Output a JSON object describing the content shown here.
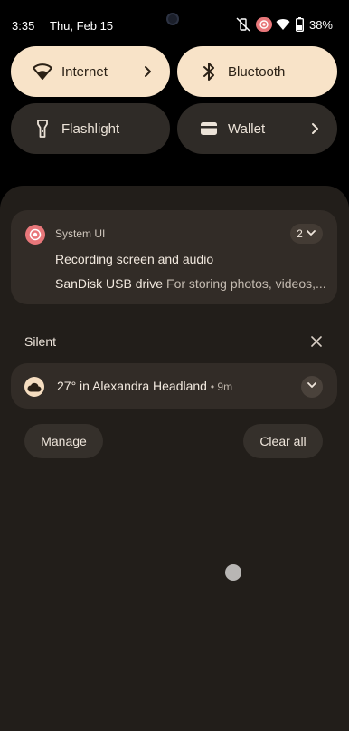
{
  "status_bar": {
    "time": "3:35",
    "date": "Thu, Feb 15",
    "battery": "38%",
    "icons": [
      "mute-vibrate-icon",
      "screen-record-icon",
      "wifi-icon",
      "battery-icon"
    ]
  },
  "quick_tiles": [
    {
      "label": "Internet",
      "icon": "wifi-icon",
      "state": "on",
      "has_chevron": true
    },
    {
      "label": "Bluetooth",
      "icon": "bluetooth-icon",
      "state": "on",
      "has_chevron": false
    },
    {
      "label": "Flashlight",
      "icon": "flashlight-icon",
      "state": "off",
      "has_chevron": false
    },
    {
      "label": "Wallet",
      "icon": "wallet-icon",
      "state": "off",
      "has_chevron": true
    }
  ],
  "notification": {
    "app_name": "System UI",
    "count": "2",
    "line1_title": "Recording screen and audio",
    "line2_title": "SanDisk USB drive",
    "line2_text": "For storing photos, videos,..."
  },
  "silent_section": {
    "label": "Silent",
    "weather_text": "27° in Alexandra Headland",
    "weather_time": "9m"
  },
  "actions": {
    "manage": "Manage",
    "clear_all": "Clear all"
  },
  "colors": {
    "tile_on": "#f8e3c8",
    "tile_off": "#2f2b27",
    "shade_bg": "#221e1a",
    "card_bg": "#322c27",
    "record_accent": "#e8777a"
  }
}
